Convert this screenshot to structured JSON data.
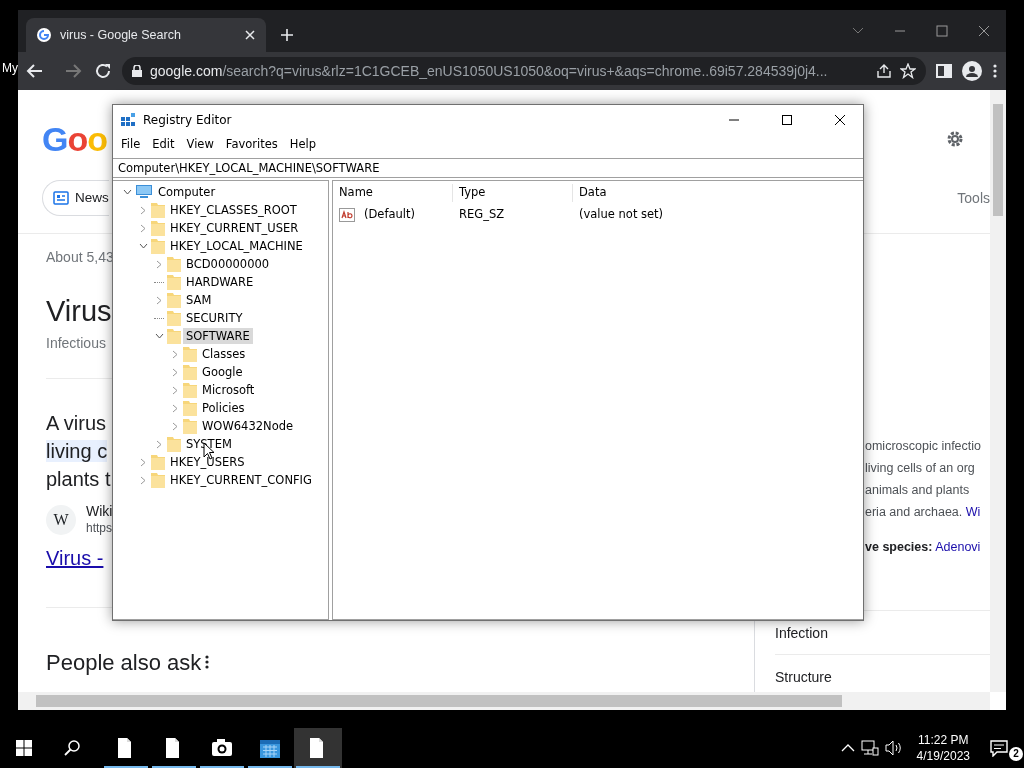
{
  "desktop": {
    "icon_label": "My"
  },
  "browser": {
    "tabs": [
      {
        "title": "virus - Google Search",
        "selected": true
      }
    ],
    "url_host": "google.com",
    "url_path": "/search?q=virus&rlz=1C1GCEB_enUS1050US1050&oq=virus+&aqs=chrome..69i57.284539j0j4..."
  },
  "search_page": {
    "logo": "Goo",
    "chips": [
      {
        "label": "News"
      }
    ],
    "tools": "Tools",
    "result_stats": "About 5,43",
    "heading": "Virus",
    "subheading": "Infectious",
    "snippet_lines": [
      {
        "text": "A virus",
        "highlighted": false
      },
      {
        "text": "living c",
        "highlighted": true
      },
      {
        "text": "plants t",
        "highlighted": false
      }
    ],
    "source": {
      "favicon": "W",
      "name": "Wiki",
      "url": "https"
    },
    "result_link": "Virus -",
    "people_also_ask": "People also ask",
    "panel": {
      "lines": [
        {
          "text": "omicroscopic infectio"
        },
        {
          "text": "living cells of an org"
        },
        {
          "text": "animals and plants"
        },
        {
          "text": "eria and archaea.",
          "link": "Wi"
        }
      ],
      "species_label": "ve species:",
      "species_link": "Adenovi",
      "sections": [
        "Infection",
        "Structure"
      ]
    }
  },
  "registry": {
    "title": "Registry Editor",
    "menu": [
      "File",
      "Edit",
      "View",
      "Favorites",
      "Help"
    ],
    "address": "Computer\\HKEY_LOCAL_MACHINE\\SOFTWARE",
    "tree": [
      {
        "label": "Computer",
        "kind": "computer",
        "expandable": true,
        "expanded": true,
        "selected": false,
        "children": [
          {
            "label": "HKEY_CLASSES_ROOT",
            "kind": "folder",
            "expandable": true,
            "expanded": false,
            "selected": false
          },
          {
            "label": "HKEY_CURRENT_USER",
            "kind": "folder",
            "expandable": true,
            "expanded": false,
            "selected": false
          },
          {
            "label": "HKEY_LOCAL_MACHINE",
            "kind": "folder",
            "expandable": true,
            "expanded": true,
            "selected": false,
            "children": [
              {
                "label": "BCD00000000",
                "kind": "folder",
                "expandable": true,
                "expanded": false,
                "selected": false
              },
              {
                "label": "HARDWARE",
                "kind": "folder",
                "expandable": false,
                "expanded": false,
                "selected": false
              },
              {
                "label": "SAM",
                "kind": "folder",
                "expandable": true,
                "expanded": false,
                "selected": false
              },
              {
                "label": "SECURITY",
                "kind": "folder",
                "expandable": false,
                "expanded": false,
                "selected": false
              },
              {
                "label": "SOFTWARE",
                "kind": "folder",
                "expandable": true,
                "expanded": true,
                "selected": true,
                "children": [
                  {
                    "label": "Classes",
                    "kind": "folder",
                    "expandable": true,
                    "expanded": false,
                    "selected": false
                  },
                  {
                    "label": "Google",
                    "kind": "folder",
                    "expandable": true,
                    "expanded": false,
                    "selected": false
                  },
                  {
                    "label": "Microsoft",
                    "kind": "folder",
                    "expandable": true,
                    "expanded": false,
                    "selected": false
                  },
                  {
                    "label": "Policies",
                    "kind": "folder",
                    "expandable": true,
                    "expanded": false,
                    "selected": false
                  },
                  {
                    "label": "WOW6432Node",
                    "kind": "folder",
                    "expandable": true,
                    "expanded": false,
                    "selected": false
                  }
                ]
              },
              {
                "label": "SYSTEM",
                "kind": "folder",
                "expandable": true,
                "expanded": false,
                "selected": false
              }
            ]
          },
          {
            "label": "HKEY_USERS",
            "kind": "folder",
            "expandable": true,
            "expanded": false,
            "selected": false
          },
          {
            "label": "HKEY_CURRENT_CONFIG",
            "kind": "folder",
            "expandable": true,
            "expanded": false,
            "selected": false
          }
        ]
      }
    ],
    "columns": [
      "Name",
      "Type",
      "Data"
    ],
    "values": [
      {
        "name": "(Default)",
        "type": "REG_SZ",
        "data": "(value not set)"
      }
    ]
  },
  "taskbar": {
    "apps": [
      {
        "kind": "file",
        "active": false
      },
      {
        "kind": "file",
        "active": false
      },
      {
        "kind": "camera",
        "active": false
      },
      {
        "kind": "calendar",
        "active": false
      },
      {
        "kind": "file",
        "active": true
      }
    ],
    "time": "11:22 PM",
    "date": "4/19/2023",
    "notifications": "2"
  }
}
